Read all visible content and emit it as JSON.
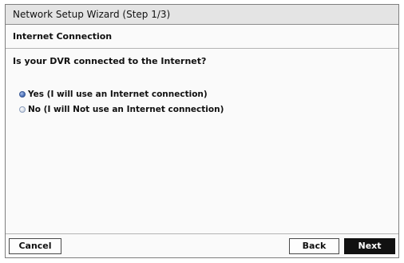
{
  "window": {
    "title": "Network Setup Wizard (Step 1/3)"
  },
  "section": {
    "heading": "Internet Connection"
  },
  "question": {
    "text": "Is your DVR connected to the Internet?"
  },
  "options": [
    {
      "label": "Yes (I will use an Internet connection)",
      "selected": true
    },
    {
      "label": "No (I will Not use an Internet connection)",
      "selected": false
    }
  ],
  "buttons": {
    "cancel": "Cancel",
    "back": "Back",
    "next": "Next"
  },
  "colors": {
    "accent": "#3f65b0",
    "next_button": "#111111",
    "titlebar": "#e4e4e4"
  }
}
